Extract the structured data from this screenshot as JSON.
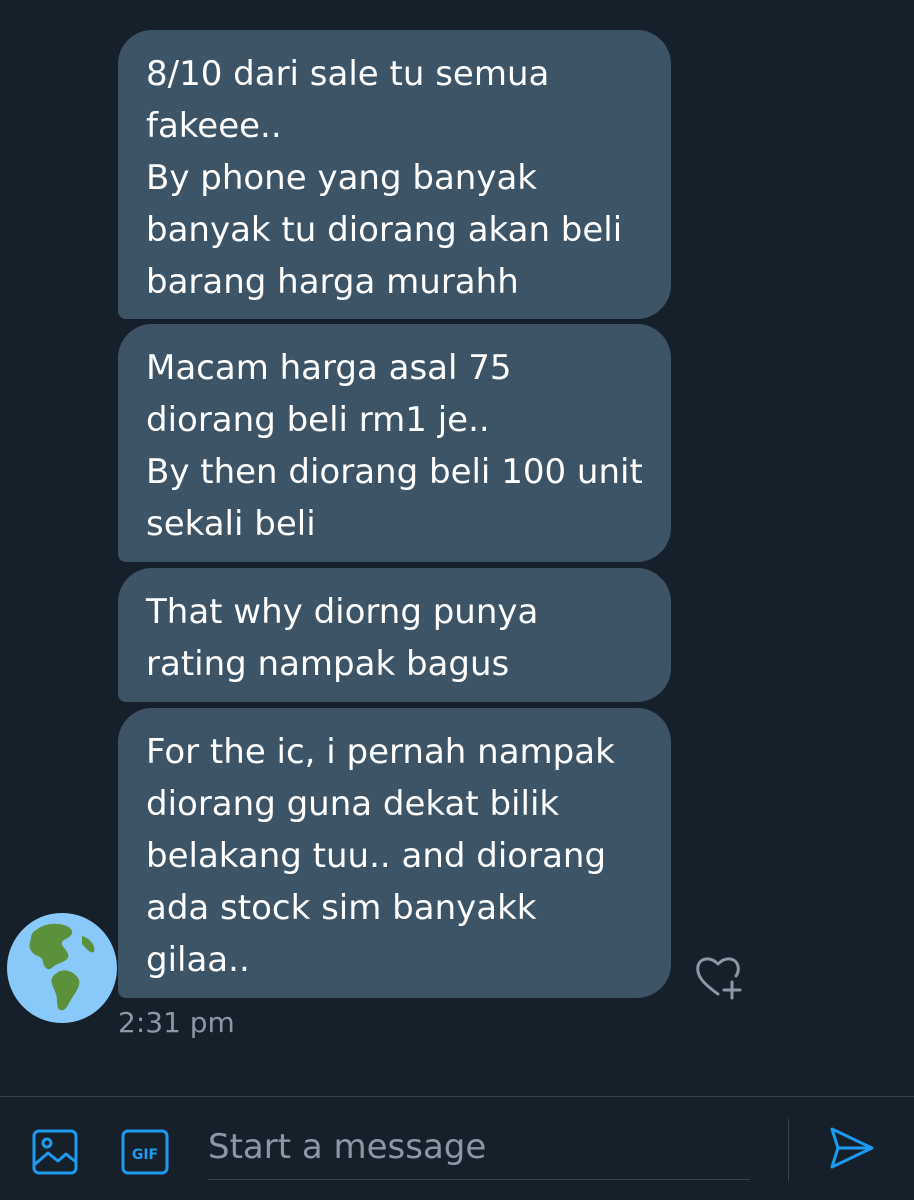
{
  "conversation": {
    "messages": [
      {
        "text": "8/10 dari sale tu semua\nfakeee..\nBy phone yang banyak\nbanyak tu diorang akan beli\nbarang harga murahh"
      },
      {
        "text": "Macam harga asal 75\ndiorang beli rm1 je..\nBy then diorang beli 100 unit\nsekali beli"
      },
      {
        "text": "That why diorng punya\nrating nampak bagus"
      },
      {
        "text": "For the ic, i pernah nampak\ndiorang guna dekat bilik\nbelakang tuu.. and diorang\nada stock sim banyakk\ngilaa.."
      }
    ],
    "timestamp": "2:31 pm",
    "avatar_icon": "earth-globe-americas-icon",
    "reaction_icon": "heart-plus-icon"
  },
  "composer": {
    "placeholder": "Start a message",
    "value": "",
    "media_icon": "image-icon",
    "gif_icon": "gif-icon",
    "gif_label": "GIF",
    "send_icon": "send-icon"
  },
  "colors": {
    "background": "#15202b",
    "bubble": "#3d5466",
    "accent": "#1d9bf0",
    "muted_text": "#8b98a5"
  }
}
